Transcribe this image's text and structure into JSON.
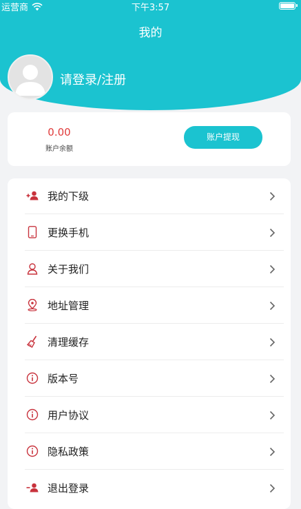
{
  "status_bar": {
    "carrier": "运营商",
    "time": "下午3:57"
  },
  "header": {
    "title": "我的",
    "login_prompt": "请登录/注册"
  },
  "balance": {
    "value": "0.00",
    "label": "账户余额",
    "withdraw_label": "账户提现"
  },
  "colors": {
    "accent": "#1bc3d0",
    "icon_red": "#c8323c",
    "balance_red": "#e03b3b"
  },
  "menu": {
    "items": [
      {
        "label": "我的下级",
        "icon": "add-user-icon"
      },
      {
        "label": "更换手机",
        "icon": "phone-icon"
      },
      {
        "label": "关于我们",
        "icon": "person-icon"
      },
      {
        "label": "地址管理",
        "icon": "location-icon"
      },
      {
        "label": "清理缓存",
        "icon": "broom-icon"
      },
      {
        "label": "版本号",
        "icon": "info-icon"
      },
      {
        "label": "用户协议",
        "icon": "info-icon"
      },
      {
        "label": "隐私政策",
        "icon": "info-icon"
      },
      {
        "label": "退出登录",
        "icon": "remove-user-icon"
      }
    ]
  }
}
